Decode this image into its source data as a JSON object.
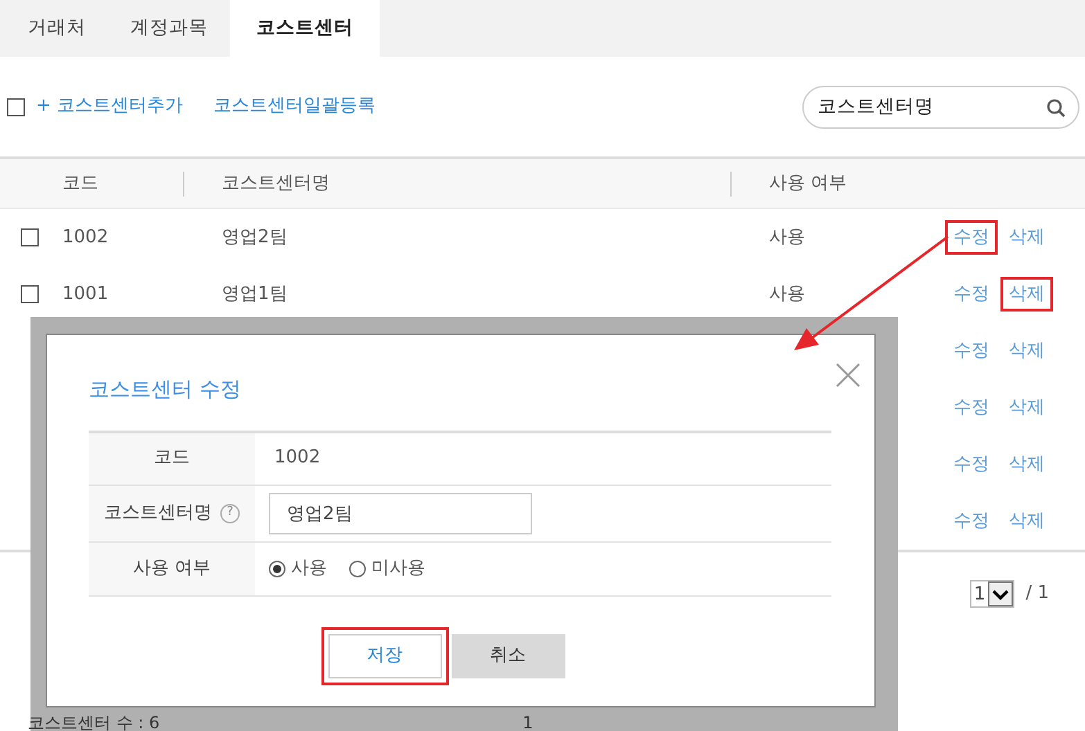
{
  "tabs": [
    {
      "label": "거래처",
      "selected": false
    },
    {
      "label": "계정과목",
      "selected": false
    },
    {
      "label": "코스트센터",
      "selected": true
    }
  ],
  "toolbar": {
    "select_all_checked": false,
    "add_link": "+ 코스트센터추가",
    "bulk_link": "코스트센터일괄등록"
  },
  "search": {
    "value": "코스트센터명"
  },
  "table": {
    "columns": [
      "코드",
      "코스트센터명",
      "사용 여부"
    ],
    "rows": [
      {
        "checked": false,
        "code": "1002",
        "name": "영업2팀",
        "usage": "사용",
        "edit": "수정",
        "delete": "삭제",
        "edit_highlighted": true,
        "delete_highlighted": false
      },
      {
        "checked": false,
        "code": "1001",
        "name": "영업1팀",
        "usage": "사용",
        "edit": "수정",
        "delete": "삭제",
        "edit_highlighted": false,
        "delete_highlighted": true
      },
      {
        "edit": "수정",
        "delete": "삭제",
        "edit_highlighted": false,
        "delete_highlighted": false
      },
      {
        "edit": "수정",
        "delete": "삭제",
        "edit_highlighted": false,
        "delete_highlighted": false
      },
      {
        "edit": "수정",
        "delete": "삭제",
        "edit_highlighted": false,
        "delete_highlighted": false
      },
      {
        "edit": "수정",
        "delete": "삭제",
        "edit_highlighted": false,
        "delete_highlighted": false
      }
    ]
  },
  "pagination": {
    "page": "1",
    "total": "/ 1"
  },
  "dialog": {
    "title": "코스트센터 수정",
    "fields": [
      {
        "kind": "text",
        "label": "코드",
        "value": "1002"
      },
      {
        "kind": "input",
        "label": "코스트센터명",
        "help": "?",
        "value": "영업2팀"
      },
      {
        "kind": "radio",
        "label": "사용 여부",
        "options": [
          {
            "label": "사용",
            "selected": true
          },
          {
            "label": "미사용",
            "selected": false
          }
        ]
      }
    ],
    "buttons": [
      {
        "label": "저장",
        "kind": "primary",
        "highlighted": true
      },
      {
        "label": "취소",
        "kind": "secondary",
        "highlighted": false
      }
    ],
    "footer_count": "코스트센터 수 : 6",
    "footer_page": "1"
  }
}
